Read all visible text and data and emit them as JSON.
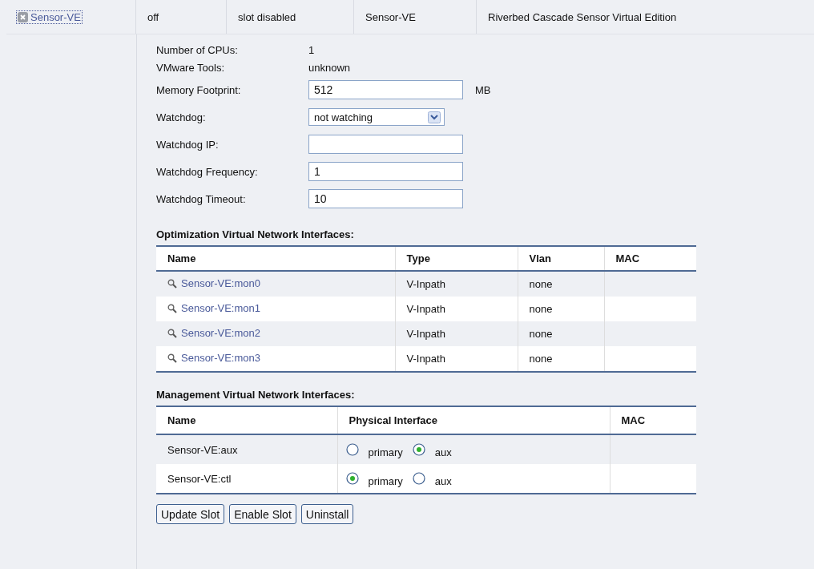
{
  "slot_row": {
    "name": "Sensor-VE",
    "cells": [
      "off",
      "slot disabled",
      "Sensor-VE",
      "Riverbed Cascade Sensor Virtual Edition"
    ]
  },
  "info": [
    {
      "label": "Number of CPUs:",
      "value": "1"
    },
    {
      "label": "VMware Tools:",
      "value": "unknown"
    }
  ],
  "fields": [
    {
      "kind": "text",
      "label": "Memory Footprint:",
      "value": "512",
      "unit": "MB"
    },
    {
      "kind": "select",
      "label": "Watchdog:",
      "value": "not watching"
    },
    {
      "kind": "text",
      "label": "Watchdog IP:"
    },
    {
      "kind": "text",
      "label": "Watchdog Frequency:",
      "value": "1"
    },
    {
      "kind": "text",
      "label": "Watchdog Timeout:",
      "value": "10"
    }
  ],
  "optimization": {
    "title": "Optimization Virtual Network Interfaces:",
    "columns": [
      "Name",
      "Type",
      "Vlan",
      "MAC"
    ],
    "rows": [
      {
        "name": "Sensor-VE:mon0",
        "type": "V-Inpath",
        "vlan": "none"
      },
      {
        "name": "Sensor-VE:mon1",
        "type": "V-Inpath",
        "vlan": "none"
      },
      {
        "name": "Sensor-VE:mon2",
        "type": "V-Inpath",
        "vlan": "none"
      },
      {
        "name": "Sensor-VE:mon3",
        "type": "V-Inpath",
        "vlan": "none"
      }
    ]
  },
  "management": {
    "title": "Management Virtual Network Interfaces:",
    "columns": [
      "Name",
      "Physical Interface",
      "MAC"
    ],
    "rows": [
      {
        "name": "Sensor-VE:aux",
        "options": [
          {
            "label": "primary",
            "selected": false
          },
          {
            "label": "aux",
            "selected": true
          }
        ]
      },
      {
        "name": "Sensor-VE:ctl",
        "options": [
          {
            "label": "primary",
            "selected": true
          },
          {
            "label": "aux",
            "selected": false
          }
        ]
      }
    ]
  },
  "buttons": [
    "Update Slot",
    "Enable Slot",
    "Uninstall"
  ]
}
